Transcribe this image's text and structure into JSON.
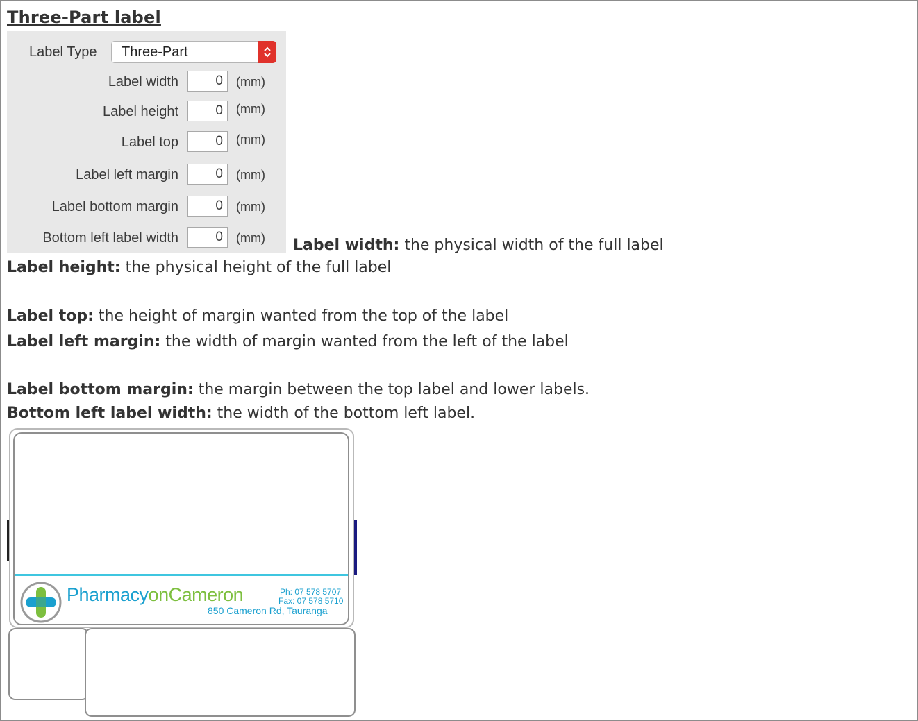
{
  "heading": "Three-Part label",
  "panel": {
    "type_label": "Label Type",
    "type_value": "Three-Part",
    "fields": [
      {
        "label": "Label width",
        "value": "0",
        "unit": "(mm)"
      },
      {
        "label": "Label height",
        "value": "0",
        "unit": "(mm)"
      },
      {
        "label": "Label top",
        "value": "0",
        "unit": "(mm)"
      },
      {
        "label": "Label left margin",
        "value": "0",
        "unit": "(mm)"
      },
      {
        "label": "Label bottom margin",
        "value": "0",
        "unit": "(mm)"
      },
      {
        "label": "Bottom left label width",
        "value": "0",
        "unit": "(mm)"
      }
    ]
  },
  "descriptions": [
    {
      "term": "Label width:",
      "text": " the physical width of the full label"
    },
    {
      "term": "Label height:",
      "text": " the physical height of the full label"
    },
    {
      "term": "Label top:",
      "text": " the height of margin wanted from the top of the label"
    },
    {
      "term": "Label left margin:",
      "text": " the width of margin wanted from the left of the label"
    },
    {
      "term": "Label bottom margin:",
      "text": " the margin between the top label and lower labels."
    },
    {
      "term": "Bottom left label width:",
      "text": " the width of the bottom left label."
    }
  ],
  "label_preview": {
    "pharmacy_name_1": "Pharmacy",
    "pharmacy_name_2": "onCameron",
    "phone": "Ph: 07 578 5707",
    "fax": "Fax: 07 578 5710",
    "address": "850 Cameron Rd, Tauranga",
    "accent_blue": "#1aa0cf",
    "accent_green": "#7dbf3f"
  }
}
